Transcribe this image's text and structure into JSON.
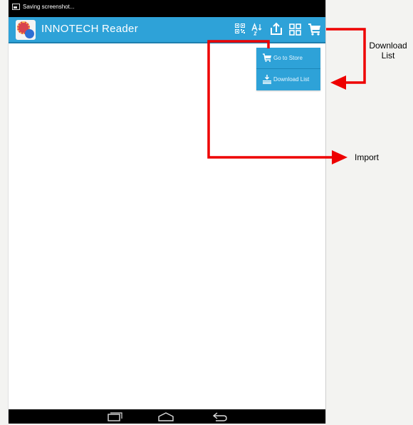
{
  "status_bar": {
    "text": "Saving screenshot..."
  },
  "app_bar": {
    "brand": "INNOTECH",
    "subtitle": "Reader",
    "actions": [
      "qr-code-icon",
      "sort-alpha-icon",
      "import-icon",
      "grid-view-icon",
      "cart-icon"
    ]
  },
  "menu": {
    "items": [
      {
        "label": "Go to Store",
        "icon": "cart-icon"
      },
      {
        "label": "Download List",
        "icon": "download-list-icon"
      }
    ]
  },
  "annotations": {
    "download_list": [
      "Download",
      "List"
    ],
    "import": "Import"
  },
  "colors": {
    "app_bar": "#2ea2d8",
    "arrow": "#ee0000"
  }
}
